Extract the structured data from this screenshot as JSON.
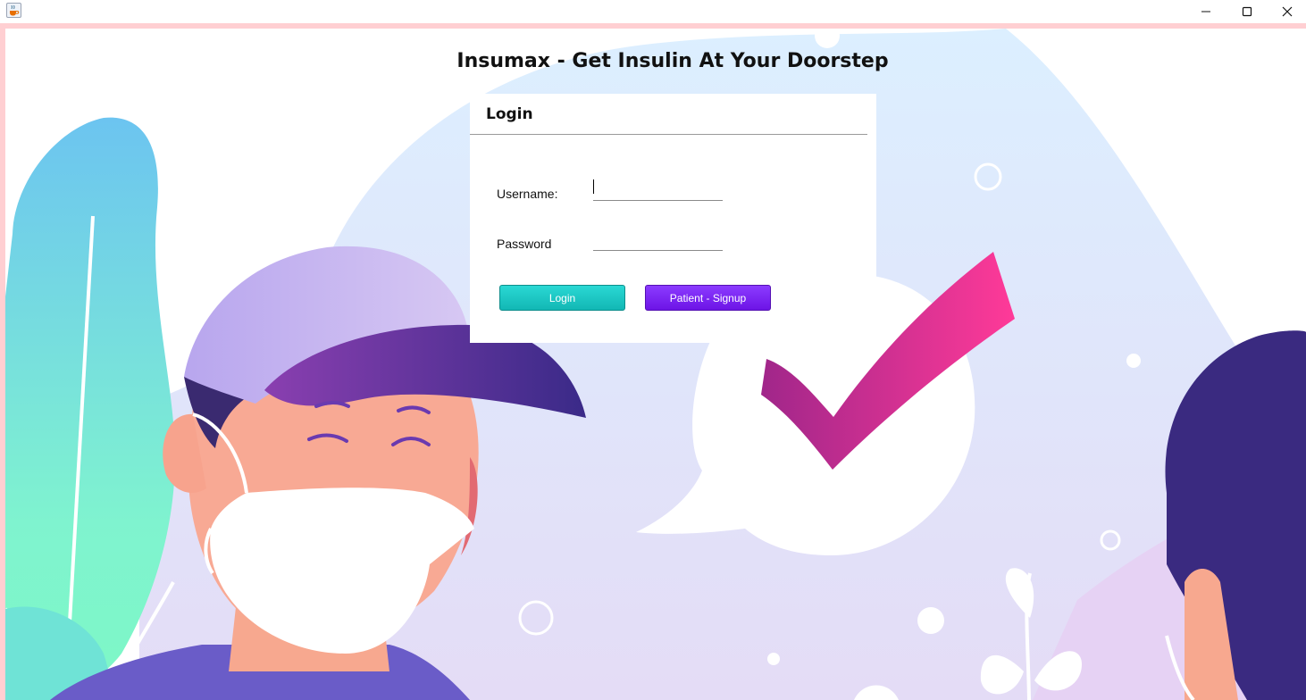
{
  "window": {
    "icon": "java-cup-icon",
    "controls": {
      "minimize": "minimize-icon",
      "maximize": "maximize-icon",
      "close": "close-icon"
    }
  },
  "app": {
    "title": "Insumax - Get Insulin At Your Doorstep"
  },
  "login": {
    "heading": "Login",
    "username_label": "Username:",
    "password_label": "Password",
    "username_value": "",
    "password_value": "",
    "login_button": "Login",
    "signup_button": "Patient - Signup"
  },
  "colors": {
    "frame": "#ffcfd2",
    "login_button": "#18c4c1",
    "signup_button": "#7a22f4",
    "checkmark": "#e0338e"
  }
}
